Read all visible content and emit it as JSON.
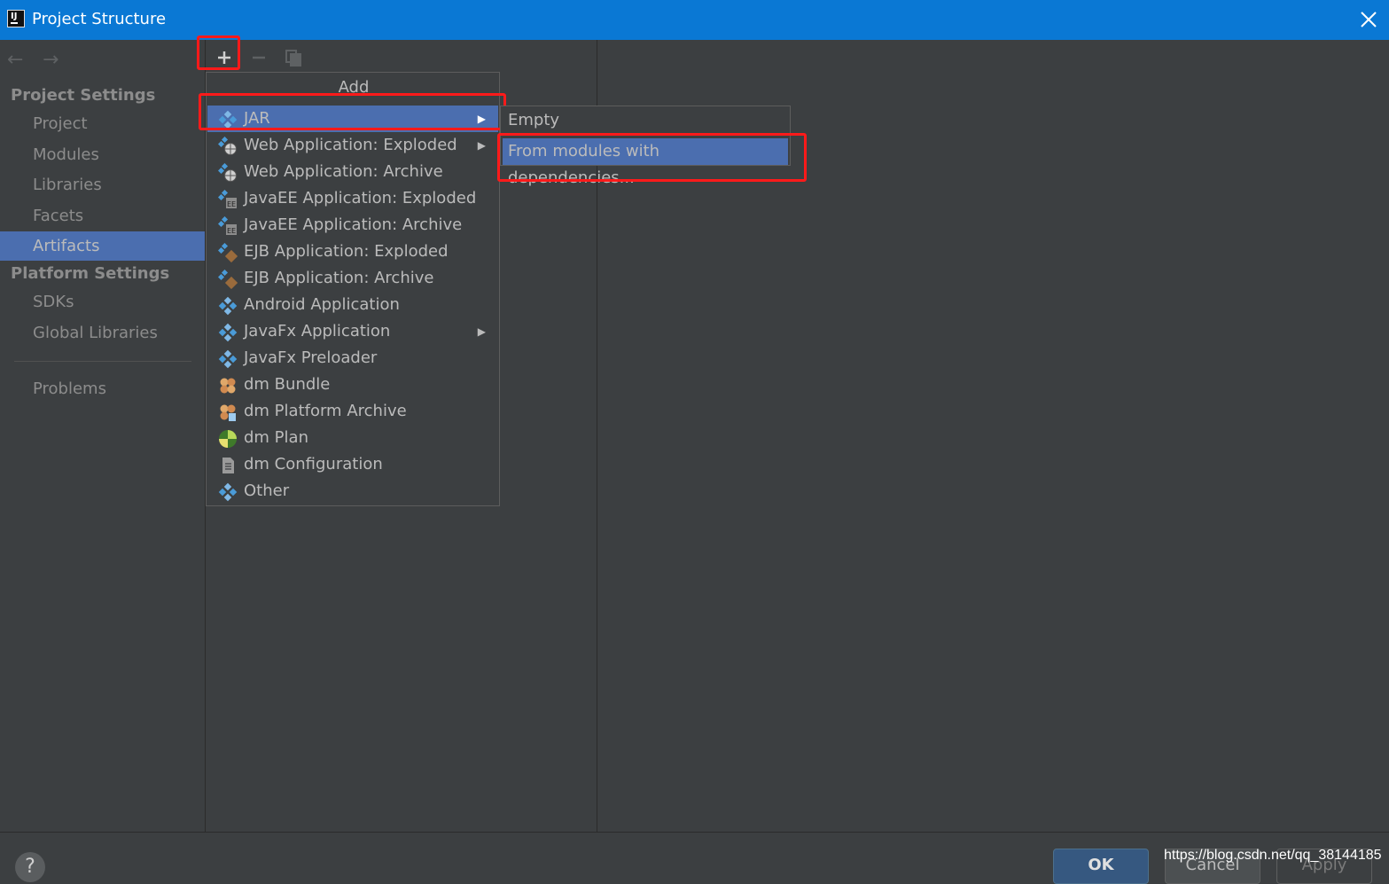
{
  "window": {
    "title": "Project Structure"
  },
  "sidebar": {
    "project_settings_header": "Project Settings",
    "project_items": [
      {
        "label": "Project"
      },
      {
        "label": "Modules"
      },
      {
        "label": "Libraries"
      },
      {
        "label": "Facets"
      },
      {
        "label": "Artifacts",
        "selected": true
      }
    ],
    "platform_settings_header": "Platform Settings",
    "platform_items": [
      {
        "label": "SDKs"
      },
      {
        "label": "Global Libraries"
      }
    ],
    "problems_label": "Problems"
  },
  "popup": {
    "title": "Add",
    "items": [
      {
        "label": "JAR",
        "icon": "artifact-icon",
        "submenu": true,
        "active": true
      },
      {
        "label": "Web Application: Exploded",
        "icon": "web-app-icon",
        "submenu": true
      },
      {
        "label": "Web Application: Archive",
        "icon": "web-app-icon"
      },
      {
        "label": "JavaEE Application: Exploded",
        "icon": "javaee-icon"
      },
      {
        "label": "JavaEE Application: Archive",
        "icon": "javaee-icon"
      },
      {
        "label": "EJB Application: Exploded",
        "icon": "ejb-icon"
      },
      {
        "label": "EJB Application: Archive",
        "icon": "ejb-icon"
      },
      {
        "label": "Android Application",
        "icon": "artifact-icon"
      },
      {
        "label": "JavaFx Application",
        "icon": "artifact-icon",
        "submenu": true
      },
      {
        "label": "JavaFx Preloader",
        "icon": "artifact-icon"
      },
      {
        "label": "dm Bundle",
        "icon": "dm-bundle-icon"
      },
      {
        "label": "dm Platform Archive",
        "icon": "dm-bundle-icon"
      },
      {
        "label": "dm Plan",
        "icon": "globe-icon"
      },
      {
        "label": "dm Configuration",
        "icon": "file-icon"
      },
      {
        "label": "Other",
        "icon": "artifact-icon"
      }
    ]
  },
  "submenu": {
    "items": [
      {
        "label": "Empty"
      },
      {
        "label": "From modules with dependencies...",
        "active": true
      }
    ]
  },
  "footer": {
    "help_label": "?",
    "ok_label": "OK",
    "cancel_label": "Cancel",
    "apply_label": "Apply",
    "watermark": "https://blog.csdn.net/qq_38144185"
  },
  "colors": {
    "titlebar": "#0a78d4",
    "background": "#3c3f41",
    "selection": "#4b6eaf",
    "highlight_frame": "#ff1a1a"
  }
}
